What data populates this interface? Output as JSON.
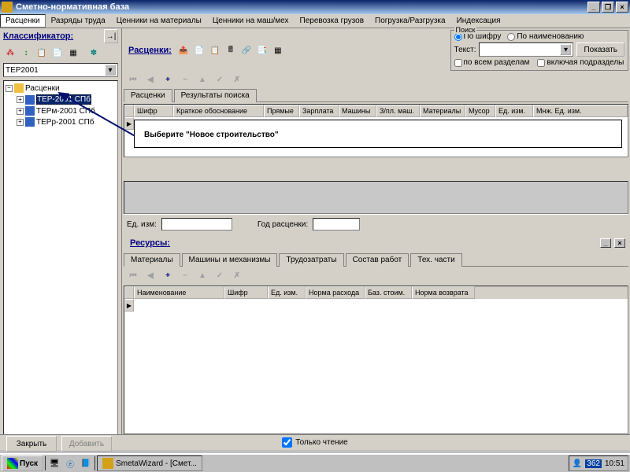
{
  "window": {
    "title": "Сметно-нормативная база"
  },
  "menu": {
    "items": [
      "Расценки",
      "Разряды труда",
      "Ценники на материалы",
      "Ценники на маш/мех",
      "Перевозка грузов",
      "Погрузка/Разгрузка",
      "Индексация"
    ]
  },
  "classifier": {
    "title": "Классификатор:",
    "combo": "ТЕР2001",
    "tree": [
      {
        "label": "Расценки",
        "icon": "folder"
      },
      {
        "label": "ТЕР-2001 СПб",
        "icon": "book",
        "selected": true
      },
      {
        "label": "ТЕРм-2001 СПб",
        "icon": "book"
      },
      {
        "label": "ТЕРр-2001 СПб",
        "icon": "book"
      }
    ]
  },
  "rates": {
    "title": "Расценки:"
  },
  "search": {
    "legend": "Поиск",
    "by_code": "По шифру",
    "by_name": "По наименованию",
    "text_label": "Текст:",
    "show_btn": "Показать",
    "all_sections": "по всем разделам",
    "incl_sub": "включая подразделы"
  },
  "rates_tabs": [
    "Расценки",
    "Результаты поиска"
  ],
  "rates_grid_headers": [
    "Шифр",
    "Краткое обоснование",
    "Прямые",
    "Зарплата",
    "Машины",
    "З/пл. маш.",
    "Материалы",
    "Мусор",
    "Ед. изм.",
    "Мнж. Ед. изм."
  ],
  "callout_text": "Выберите \"Новое строительство\"",
  "unit_label": "Ед. изм:",
  "year_label": "Год расценки:",
  "resources": {
    "title": "Ресурсы:",
    "tabs": [
      "Материалы",
      "Машины и механизмы",
      "Трудозатраты",
      "Состав работ",
      "Тех. части"
    ],
    "grid_headers": [
      "Наименование",
      "Шифр",
      "Ед. изм.",
      "Норма расхода",
      "Баз. стоим.",
      "Норма возврата"
    ]
  },
  "buttons": {
    "close": "Закрыть",
    "add": "Добавить"
  },
  "readonly_label": "Только чтение",
  "taskbar": {
    "start": "Пуск",
    "app": "SmetaWizard - [Смет...",
    "time": "10:51",
    "lang": "362"
  }
}
